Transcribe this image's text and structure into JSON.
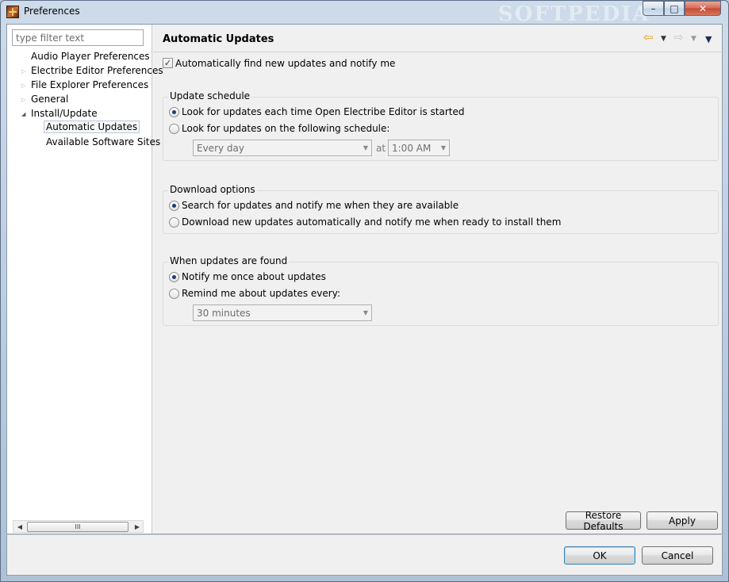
{
  "window": {
    "title": "Preferences",
    "watermark": "SOFTPEDIA",
    "controls": {
      "minimize": "–",
      "maximize": "□",
      "close": "✕"
    }
  },
  "sidebar": {
    "filter_placeholder": "type filter text",
    "items": [
      {
        "label": "Audio Player Preferences",
        "level": 0,
        "expander": ""
      },
      {
        "label": "Electribe Editor Preferences",
        "level": 0,
        "expander": "▷"
      },
      {
        "label": "File Explorer Preferences",
        "level": 0,
        "expander": "▷"
      },
      {
        "label": "General",
        "level": 0,
        "expander": "▷"
      },
      {
        "label": "Install/Update",
        "level": 0,
        "expander": "◢"
      },
      {
        "label": "Automatic Updates",
        "level": 1,
        "selected": true
      },
      {
        "label": "Available Software Sites",
        "level": 1
      }
    ],
    "scrollbar": {
      "left": "◀",
      "right": "▶",
      "grip": "III"
    }
  },
  "page": {
    "title": "Automatic Updates",
    "nav": {
      "back_icon": "⇦",
      "forward_icon": "⇨",
      "dropdown": "▼"
    },
    "auto_find": {
      "label": "Automatically find new updates and notify me",
      "checked": true
    },
    "update_schedule": {
      "title": "Update schedule",
      "options": [
        {
          "label": "Look for updates each time Open Electribe Editor is started",
          "selected": true
        },
        {
          "label": "Look for updates on the following schedule:",
          "selected": false
        }
      ],
      "day_combo": "Every day",
      "at_label": "at",
      "time_combo": "1:00 AM"
    },
    "download_options": {
      "title": "Download options",
      "options": [
        {
          "label": "Search for updates and notify me when they are available",
          "selected": true
        },
        {
          "label": "Download new updates automatically and notify me when ready to install them",
          "selected": false
        }
      ]
    },
    "when_found": {
      "title": "When updates are found",
      "options": [
        {
          "label": "Notify me once about updates",
          "selected": true
        },
        {
          "label": "Remind me about updates every:",
          "selected": false
        }
      ],
      "interval_combo": "30 minutes"
    },
    "restore_defaults": "Restore Defaults",
    "apply": "Apply"
  },
  "footer": {
    "ok": "OK",
    "cancel": "Cancel"
  },
  "colors": {
    "accent": "#3c7fb1",
    "radio_dot": "#1c3d72",
    "back_arrow": "#e2a21a"
  }
}
